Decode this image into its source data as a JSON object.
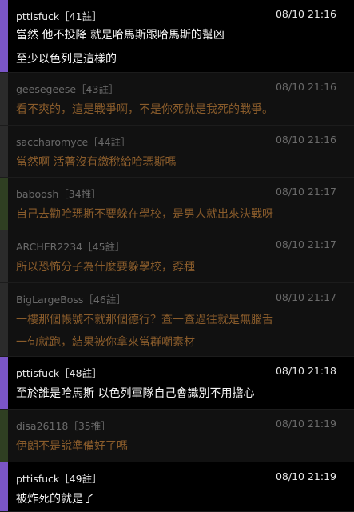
{
  "comments": [
    {
      "user": "pttisfuck",
      "tag": "［41註］",
      "time": "08/10 21:16",
      "lines": [
        "當然 他不投降 就是哈馬斯跟哈馬斯的幫凶",
        "至少以色列是這樣的"
      ],
      "style": "hl"
    },
    {
      "user": "geesegeese",
      "tag": "［43註］",
      "time": "08/10 21:16",
      "lines": [
        "看不爽的，這是戰爭啊，不是你死就是我死的戰爭。"
      ],
      "style": "dim"
    },
    {
      "user": "saccharomyce",
      "tag": "［44註］",
      "time": "08/10 21:16",
      "lines": [
        "當然啊 活著沒有繳稅給哈瑪斯嗎"
      ],
      "style": "dim"
    },
    {
      "user": "baboosh",
      "tag": "［34推］",
      "time": "08/10 21:17",
      "lines": [
        "自己去勸哈瑪斯不要躲在學校，是男人就出來決戰呀"
      ],
      "style": "dim green"
    },
    {
      "user": "ARCHER2234",
      "tag": "［45註］",
      "time": "08/10 21:17",
      "lines": [
        "所以恐怖分子為什麼要躲學校，孬種"
      ],
      "style": "dim"
    },
    {
      "user": "BigLargeBoss",
      "tag": "［46註］",
      "time": "08/10 21:17",
      "lines": [
        "一樓那個帳號不就那個德行？查一查過往就是無腦舌",
        "一句就跑，結果被你拿來當群嘲素材"
      ],
      "style": "dim"
    },
    {
      "user": "pttisfuck",
      "tag": "［48註］",
      "time": "08/10 21:18",
      "lines": [
        "至於誰是哈馬斯 以色列軍隊自己會識別不用擔心"
      ],
      "style": "hl"
    },
    {
      "user": "disa26118",
      "tag": "［35推］",
      "time": "08/10 21:19",
      "lines": [
        "伊朗不是說準備好了嗎"
      ],
      "style": "dim green"
    },
    {
      "user": "pttisfuck",
      "tag": "［49註］",
      "time": "08/10 21:19",
      "lines": [
        "被炸死的就是了"
      ],
      "style": "hl"
    }
  ]
}
